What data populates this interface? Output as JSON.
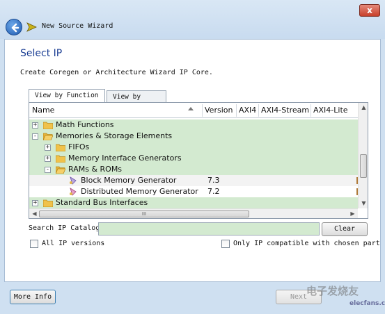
{
  "window": {
    "title": "New Source Wizard",
    "close_glyph": "x"
  },
  "page": {
    "heading": "Select IP",
    "subtitle": "Create Coregen or Architecture Wizard IP Core."
  },
  "tabs": [
    {
      "label": "View by Function",
      "active": true
    },
    {
      "label": "View by Name",
      "active": false
    }
  ],
  "columns": {
    "name": "Name",
    "version": "Version",
    "axi4": "AXI4",
    "axi4_stream": "AXI4-Stream",
    "axi4_lite": "AXI4-Lite"
  },
  "tree": {
    "rows": [
      {
        "label": "Math Functions",
        "version": "",
        "expander": "+",
        "level": 0
      },
      {
        "label": "Memories & Storage Elements",
        "version": "",
        "expander": "-",
        "level": 0
      },
      {
        "label": "FIFOs",
        "version": "",
        "expander": "+",
        "level": 1
      },
      {
        "label": "Memory Interface Generators",
        "version": "",
        "expander": "+",
        "level": 1
      },
      {
        "label": "RAMs & ROMs",
        "version": "",
        "expander": "-",
        "level": 1
      },
      {
        "label": "Block Memory Generator",
        "version": "7.3",
        "expander": "",
        "level": 2
      },
      {
        "label": "Distributed Memory Generator",
        "version": "7.2",
        "expander": "",
        "level": 2
      },
      {
        "label": "Standard Bus Interfaces",
        "version": "",
        "expander": "+",
        "level": 0
      }
    ],
    "hscroll_grip": "III"
  },
  "search": {
    "label": "Search IP Catalog:",
    "value": "",
    "clear_label": "Clear"
  },
  "options": {
    "all_versions_label": "All IP versions",
    "all_versions_checked": false,
    "compatible_label": "Only IP compatible with chosen part",
    "compatible_checked": false
  },
  "footer": {
    "more_info_label": "More Info",
    "next_label": "Next"
  },
  "watermark": {
    "text": "电子发烧友",
    "sub": "elecfans.com"
  },
  "colors": {
    "highlight_row": "#d3ead0",
    "heading": "#1c3f94"
  }
}
